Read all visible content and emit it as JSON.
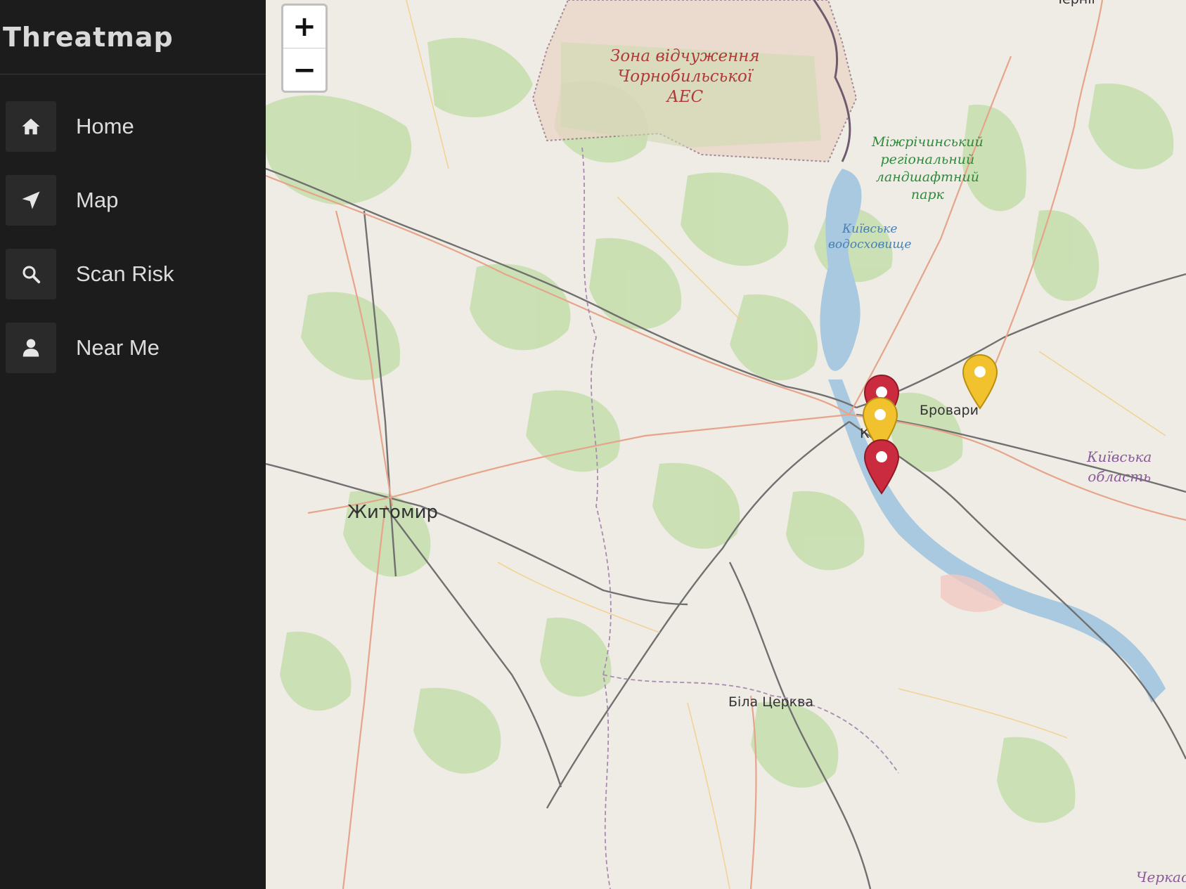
{
  "app": {
    "title": "Threatmap"
  },
  "sidebar": {
    "items": [
      {
        "label": "Home",
        "icon": "home-icon"
      },
      {
        "label": "Map",
        "icon": "location-arrow-icon"
      },
      {
        "label": "Scan Risk",
        "icon": "search-icon"
      },
      {
        "label": "Near Me",
        "icon": "user-icon"
      }
    ]
  },
  "map": {
    "zoom_in": "+",
    "zoom_out": "−",
    "labels": {
      "chernihiv": "Черніг",
      "zone_line1": "Зона відчуження",
      "zone_line2": "Чорнобильської",
      "zone_line3": "АЕС",
      "park_line1": "Міжрічинський",
      "park_line2": "регіональний",
      "park_line3": "ландшафтний",
      "park_line4": "парк",
      "reservoir_line1": "Київське",
      "reservoir_line2": "водосховище",
      "kyiv": "Київ",
      "brovary": "Бровари",
      "oblast_line1": "Київська",
      "oblast_line2": "область",
      "zhytomyr": "Житомир",
      "bila_tserkva": "Біла Церква",
      "cherkasy": "Черкас"
    },
    "markers": [
      {
        "name": "red",
        "color": "#cb2b3e"
      },
      {
        "name": "yellow",
        "color": "#f2c12e"
      },
      {
        "name": "red",
        "color": "#cb2b3e"
      },
      {
        "name": "yellow",
        "color": "#f2c12e"
      }
    ]
  },
  "colors": {
    "sidebar_bg": "#1c1c1c",
    "icon_tile": "#2a2a2a",
    "map_land": "#efece5",
    "forest": "#c7dfae",
    "water": "#a8c9e0",
    "marker_red": "#cb2b3e",
    "marker_yellow": "#f2c12e"
  }
}
